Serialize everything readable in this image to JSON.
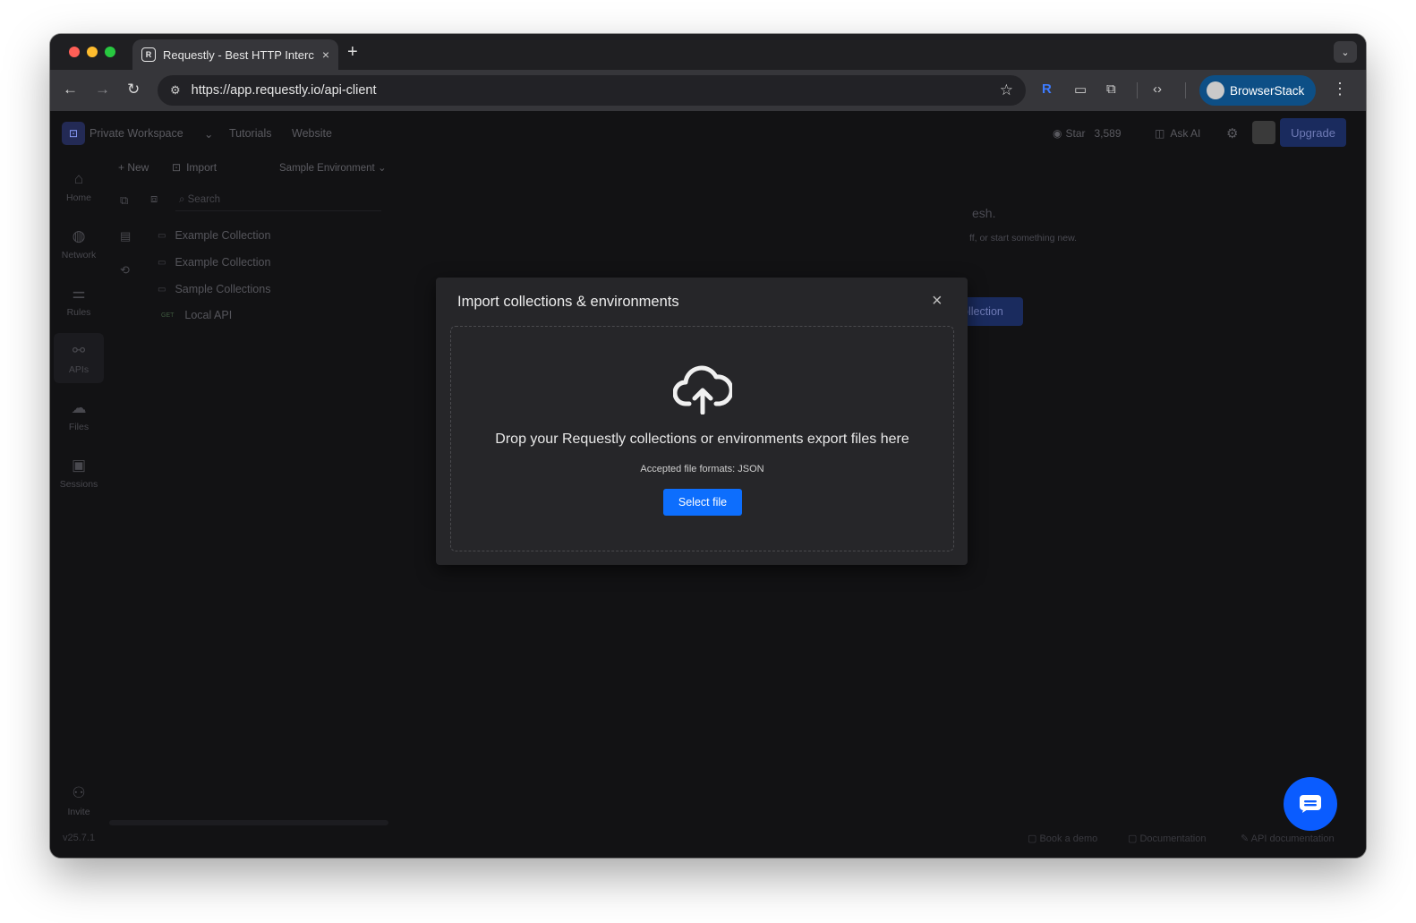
{
  "browser": {
    "tab": {
      "favicon": "R",
      "title": "Requestly - Best HTTP Interc",
      "close": "×"
    },
    "new_tab": "+",
    "tab_menu": "⌄",
    "back": "←",
    "forward": "→",
    "reload": "↻",
    "site_info": "⚙",
    "url": "https://app.requestly.io/api-client",
    "bookmark": "☆",
    "requestly_ext": "R",
    "cast": "▭",
    "extensions": "⧉",
    "devtools": "‹›",
    "profile_name": "BrowserStack",
    "menu": "⋮"
  },
  "header": {
    "workspace_icon": "⊡",
    "workspace": "Private Workspace",
    "workspace_chevron": "⌄",
    "tutorials": "Tutorials",
    "website": "Website",
    "github_icon": "◉",
    "star": "Star",
    "star_count": "3,589",
    "ask_ai_icon": "◫",
    "ask_ai": "Ask AI",
    "settings_icon": "⚙",
    "upgrade": "Upgrade"
  },
  "rail": [
    {
      "icon": "⌂",
      "label": "Home"
    },
    {
      "icon": "◍",
      "label": "Network"
    },
    {
      "icon": "⚌",
      "label": "Rules"
    },
    {
      "icon": "⚯",
      "label": "APIs"
    },
    {
      "icon": "☁",
      "label": "Files"
    },
    {
      "icon": "▣",
      "label": "Sessions"
    },
    {
      "icon": "⚇",
      "label": "Invite"
    }
  ],
  "version": "v25.7.1",
  "side_panel": {
    "new": "+ New",
    "import_icon": "⊡",
    "import": "Import",
    "environment": "Sample Environment ⌄",
    "collections_icon": "⧉",
    "env_icon": "▤",
    "history_icon": "⟲",
    "select_icon": "⧈",
    "search_placeholder": "⌕  Search",
    "tree": [
      {
        "icon": "▭",
        "label": "Example Collection"
      },
      {
        "icon": "▭",
        "label": "Example Collection"
      },
      {
        "icon": "▭",
        "label": "Sample Collections"
      },
      {
        "tag": "GET",
        "label": "Local API"
      }
    ]
  },
  "background_main": {
    "heading_fragment": "esh.",
    "sub_fragment": "ff, or start something new.",
    "button_fragment": "ollection"
  },
  "footer": {
    "book_demo": "▢ Book a demo",
    "documentation": "▢ Documentation",
    "api_docs": "✎ API documentation"
  },
  "modal": {
    "title": "Import collections & environments",
    "close": "×",
    "drop_text": "Drop your Requestly collections or environments export files here",
    "accepted": "Accepted file formats: JSON",
    "select_button": "Select file"
  }
}
